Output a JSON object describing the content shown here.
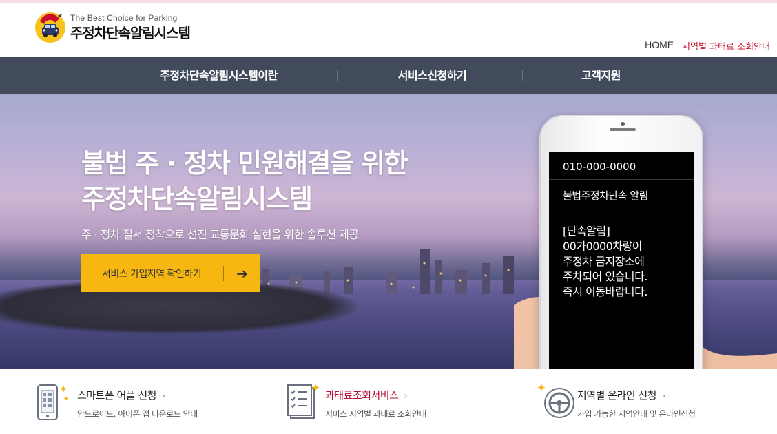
{
  "header": {
    "logo_tagline": "The Best Choice for Parking",
    "logo_name": "주정차단속알림시스템",
    "util_links": {
      "home": "HOME",
      "region_fee": "지역별 과태료 조회안내"
    }
  },
  "nav": {
    "items": [
      {
        "label": "주정차단속알림시스템이란"
      },
      {
        "label": "서비스신청하기"
      },
      {
        "label": "고객지원"
      }
    ]
  },
  "hero": {
    "title_line1": "불법 주 · 정차 민원해결을 위한",
    "title_line2": "주정차단속알림시스템",
    "subtitle": "주 · 정차 질서 정착으로 선진 교통문화 실현을 위한 솔루션 제공",
    "cta_label": "서비스 가입지역 확인하기",
    "cta_arrow": "➔"
  },
  "phone": {
    "number": "010-000-0000",
    "title": "불법주정차단속 알림",
    "message_lines": [
      "[단속알림]",
      "00가0000차량이",
      "주정차 금지장소에",
      "주차되어 있습니다.",
      "즉시 이동바랍니다."
    ]
  },
  "services": [
    {
      "title": "스마트폰 어플 신청",
      "desc": "안드로이드, 아이폰 앱 다운로드 안내",
      "icon": "smartphone-app-icon",
      "chevron": "›"
    },
    {
      "title": "과태료조회서비스",
      "desc": "서비스 지역별 과태료 조회안내",
      "icon": "document-checklist-icon",
      "chevron": "›"
    },
    {
      "title": "지역별 온라인 신청",
      "desc": "가입 가능한 지역안내 및 온라인신청",
      "icon": "steering-wheel-icon",
      "chevron": "›"
    }
  ],
  "colors": {
    "nav_bg": "#414b5b",
    "cta_bg": "#f7b710",
    "accent_red": "#c8102e",
    "service_highlight": "#b3123a"
  }
}
